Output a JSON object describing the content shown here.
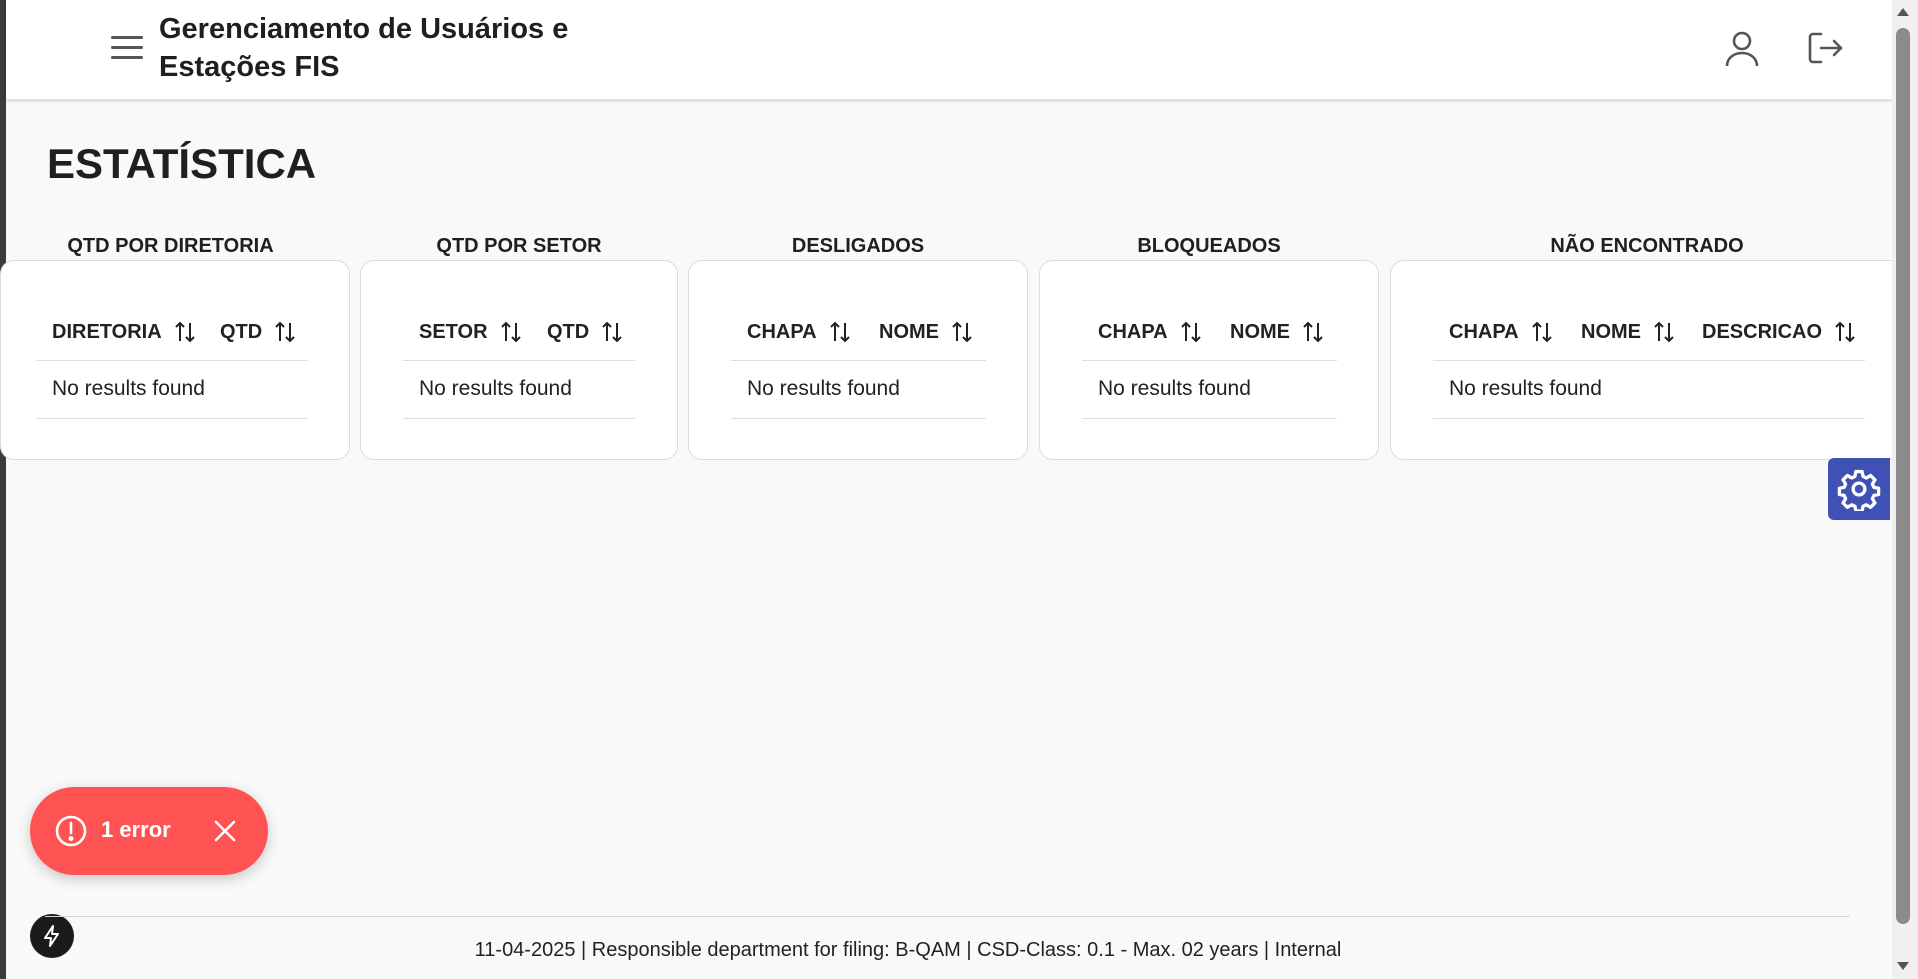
{
  "header": {
    "title": "Gerenciamento de Usuários e Estações FIS"
  },
  "page": {
    "title": "ESTATÍSTICA"
  },
  "panels": [
    {
      "title": "QTD POR DIRETORIA",
      "columns": [
        "DIRETORIA",
        "QTD"
      ],
      "empty_text": "No results found"
    },
    {
      "title": "QTD POR SETOR",
      "columns": [
        "SETOR",
        "QTD"
      ],
      "empty_text": "No results found"
    },
    {
      "title": "DESLIGADOS",
      "columns": [
        "CHAPA",
        "NOME"
      ],
      "empty_text": "No results found"
    },
    {
      "title": "BLOQUEADOS",
      "columns": [
        "CHAPA",
        "NOME"
      ],
      "empty_text": "No results found"
    },
    {
      "title": "NÃO ENCONTRADO",
      "columns": [
        "CHAPA",
        "NOME",
        "DESCRICAO"
      ],
      "empty_text": "No results found"
    }
  ],
  "toast": {
    "label": "1 error"
  },
  "footer": {
    "text": "11-04-2025 | Responsible department for filing: B-QAM | CSD-Class: 0.1 - Max. 02 years | Internal"
  },
  "colors": {
    "accent": "#3f51b5",
    "error": "#ff5252"
  },
  "icons": [
    "menu-icon",
    "user-icon",
    "logout-icon",
    "sort-icon",
    "gear-icon",
    "alert-icon",
    "close-icon",
    "bolt-icon"
  ]
}
